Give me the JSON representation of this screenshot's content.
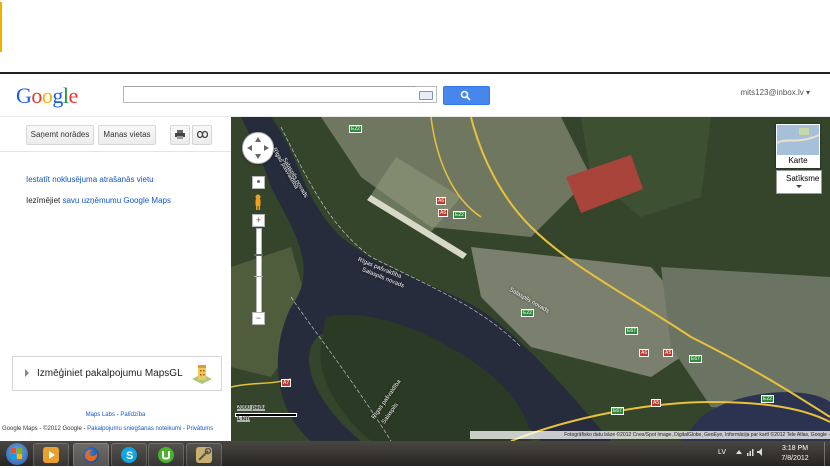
{
  "header": {
    "logo": "Google",
    "logo_colors": [
      "#1a5ce6",
      "#e8342a",
      "#f5b400",
      "#1a5ce6",
      "#159a38",
      "#e8342a"
    ],
    "search_value": "",
    "search_button_icon": "search-icon",
    "user_email": "mits123@inbox.lv",
    "user_caret": "▾"
  },
  "sidebar": {
    "directions_label": "Saņemt norādes",
    "my_places_label": "Manas vietas",
    "print_icon": "print-icon",
    "link_icon": "link-icon",
    "default_location_link": "Iestatīt noklusējuma atrašanās vietu",
    "embed_prefix": "Iezīmējiet ",
    "embed_link": "savu uzņēmumu Google Maps",
    "promo_text": "Izmēģiniet pakalpojumu MapsGL",
    "footer_labs": "Maps Labs",
    "footer_sep": " - ",
    "footer_help": "Palīdzība",
    "footer_copyright": "Google Maps - ©2012 Google - ",
    "footer_terms": "Pakalpojumu sniegšanas noteikumi",
    "footer_privacy": "Privātums"
  },
  "map": {
    "type_label": "Karte",
    "satellite_label": "Satīksme",
    "scale_top": "2000 pēdu",
    "scale_bottom": "1 km",
    "attribution": "Fotogrāfisko datu bāze ©2012 Cnes/Spot Image, DigitalGlobe, GeoEye, Informācija par kartī ©2012 Tele Atlas, Google -",
    "road_labels": [
      "E22",
      "A6",
      "E22",
      "A6",
      "E22",
      "E67",
      "A5",
      "E67",
      "A7",
      "E67",
      "A5",
      "A6",
      "E22"
    ],
    "river_labels": [
      "Rīgas pašvaldība",
      "Salaspils novads",
      "Rīgas pašvaldība",
      "Salaspils novads",
      "Salaspils novads",
      "Rīgas pašvaldība",
      "Salaspils"
    ],
    "colors": {
      "forest": "#33442b",
      "river": "#252b3a",
      "fields": "#6d7a58",
      "urban": "#8a8a7e",
      "road": "#e8c23a",
      "courts": "#a8443a"
    }
  },
  "taskbar": {
    "language": "LV",
    "time": "3:18 PM",
    "date": "7/8/2012",
    "apps": [
      {
        "name": "media-player",
        "icon": "media-player-icon"
      },
      {
        "name": "firefox",
        "icon": "firefox-icon"
      },
      {
        "name": "skype",
        "icon": "skype-icon"
      },
      {
        "name": "utorrent",
        "icon": "utorrent-icon"
      },
      {
        "name": "tools",
        "icon": "tools-icon"
      }
    ]
  }
}
